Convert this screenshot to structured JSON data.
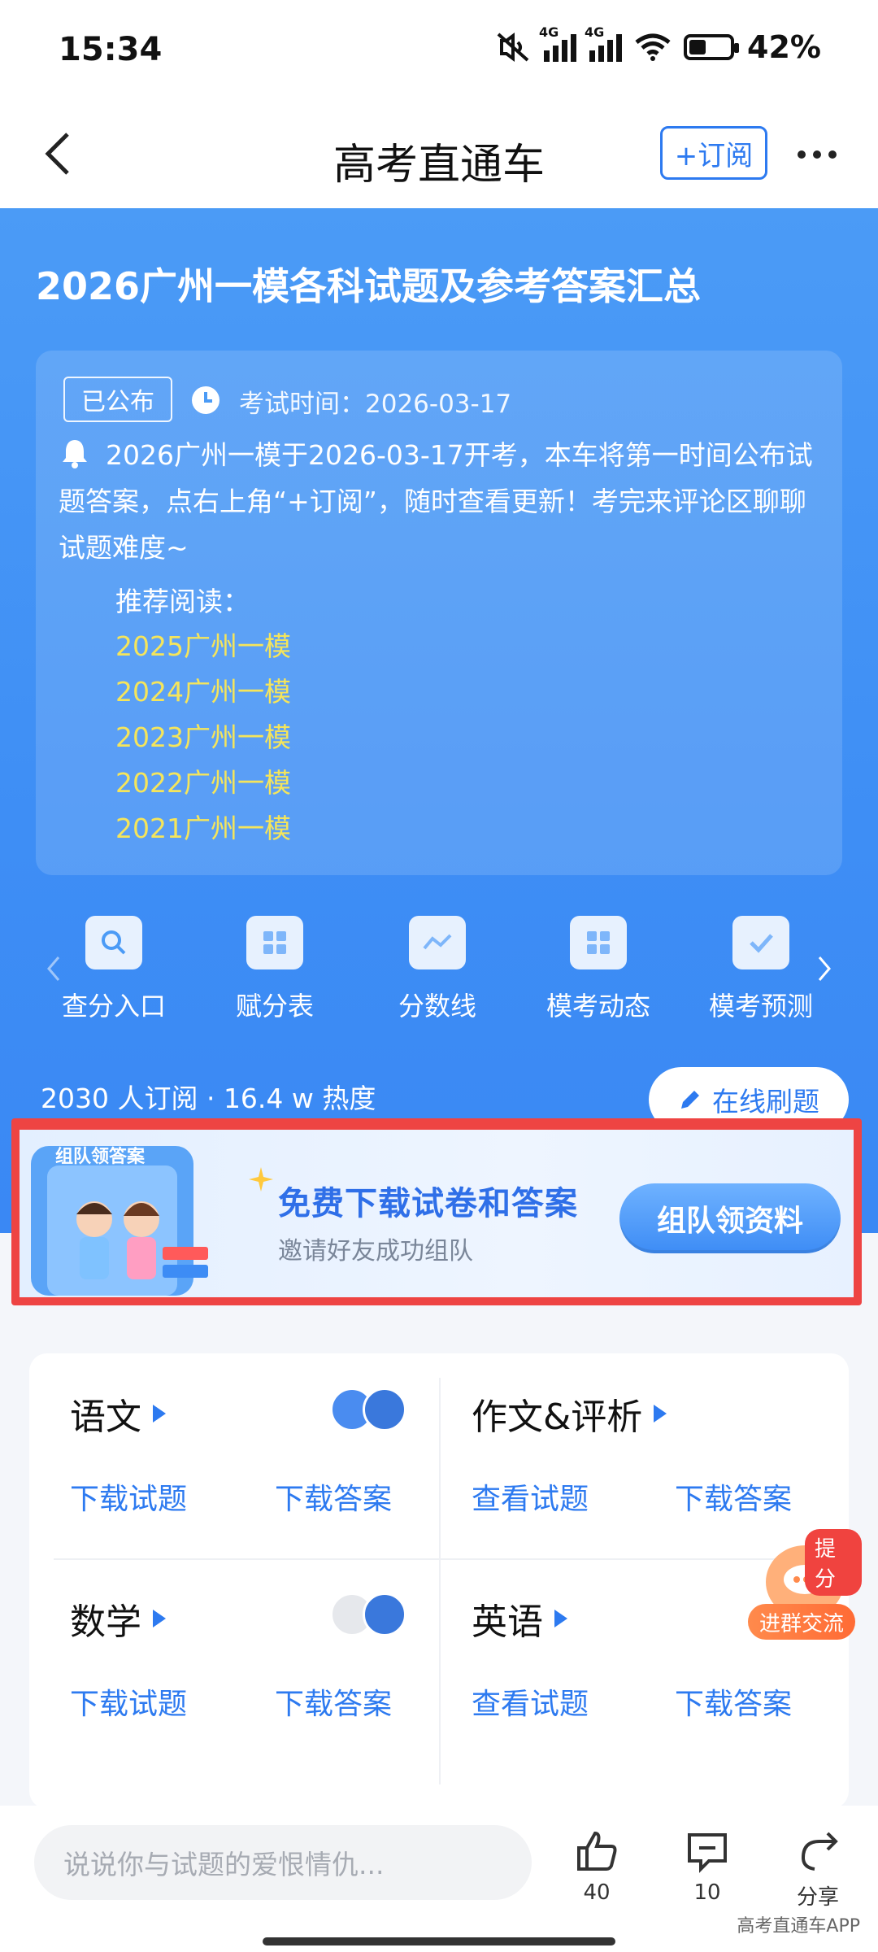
{
  "status_bar": {
    "time": "15:34",
    "network_1": "4G",
    "network_2": "4G",
    "battery": "42%",
    "battery_level": 0.42
  },
  "nav": {
    "title": "高考直通车",
    "subscribe": "+订阅"
  },
  "hero": {
    "title": "2026广州一模各科试题及参考答案汇总",
    "badge": "已公布",
    "exam_time": "考试时间：2026-03-17",
    "notice": "2026广州一模于2026-03-17开考，本车将第一时间公布试题答案，点右上角“+订阅”，随时查看更新！考完来评论区聊聊试题难度~",
    "recommend_title": "推荐阅读：",
    "recommend": [
      "2025广州一模",
      "2024广州一模",
      "2023广州一模",
      "2022广州一模",
      "2021广州一模"
    ],
    "link_color": "#f5e55b"
  },
  "quick_nav": [
    {
      "label": "查分入口",
      "icon": "search-icon"
    },
    {
      "label": "赋分表",
      "icon": "grid-icon"
    },
    {
      "label": "分数线",
      "icon": "trend-icon"
    },
    {
      "label": "模考动态",
      "icon": "grid-icon"
    },
    {
      "label": "模考预测",
      "icon": "check-icon"
    }
  ],
  "stats": {
    "text": "2030 人订阅 · 16.4 w 热度",
    "online_practice": "在线刷题"
  },
  "promo": {
    "art_title": "组队领答案",
    "title": "免费下载试卷和答案",
    "subtitle": "邀请好友成功组队",
    "button": "组队领资料"
  },
  "subjects": [
    {
      "name": "语文",
      "actions": [
        "下载试题",
        "下载答案"
      ]
    },
    {
      "name": "作文&评析",
      "actions": [
        "查看试题",
        "下载答案"
      ]
    },
    {
      "name": "数学",
      "actions": [
        "下载试题",
        "下载答案"
      ]
    },
    {
      "name": "英语",
      "actions": [
        "查看试题",
        "下载答案"
      ]
    }
  ],
  "float": {
    "badge": "提分",
    "label": "进群交流"
  },
  "bottom_bar": {
    "comment_placeholder": "说说你与试题的爱恨情仇...",
    "likes": "40",
    "comments": "10",
    "share": "分享",
    "watermark": "高考直通车APP"
  },
  "colors": {
    "accent": "#2d7af0",
    "hero_bg": "#4b9bf6",
    "highlight_border": "#ee4443"
  }
}
